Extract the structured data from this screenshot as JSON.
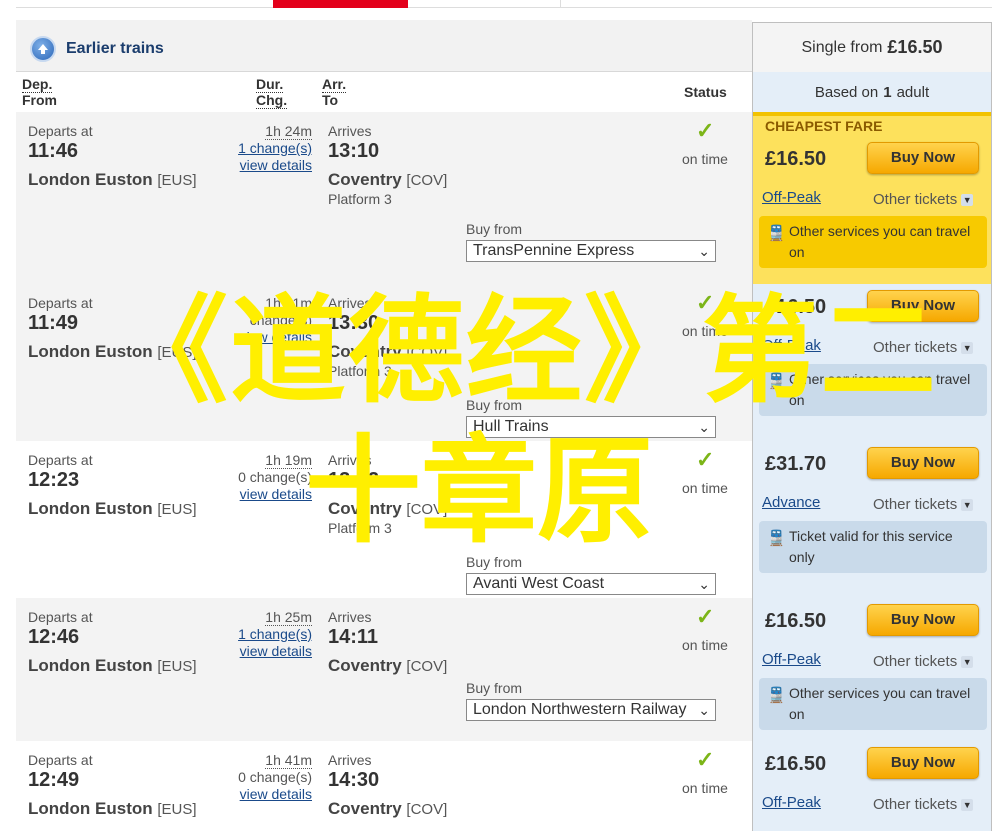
{
  "header": {
    "earlier_label": "Earlier trains",
    "single_from_label": "Single from",
    "single_from_price": "£16.50",
    "based_on_prefix": "Based on",
    "based_on_count": "1",
    "based_on_suffix": "adult"
  },
  "columns": {
    "dep_abbr": "Dep.",
    "dep_full": "From",
    "dur_abbr": "Dur.",
    "chg_abbr": "Chg.",
    "arr_abbr": "Arr.",
    "arr_full": "To",
    "status": "Status"
  },
  "labels": {
    "departs_at": "Departs at",
    "arrives": "Arrives",
    "on_time": "on time",
    "buy_from": "Buy from",
    "view_details": "view details",
    "buy_now": "Buy Now",
    "other_tickets": "Other tickets",
    "cheapest_fare": "CHEAPEST FARE"
  },
  "journeys": [
    {
      "depart_time": "11:46",
      "depart_station": "London Euston",
      "depart_code": "[EUS]",
      "duration": "1h 24m",
      "changes": "1 change(s)",
      "arrive_time": "13:10",
      "arrive_station": "Coventry",
      "arrive_code": "[COV]",
      "platform": "Platform 3",
      "operator": "TransPennine Express",
      "price": "£16.50",
      "fare_type": "Off-Peak",
      "service_note": "Other services you can travel on"
    },
    {
      "depart_time": "11:49",
      "depart_station": "London Euston",
      "depart_code": "[EUS]",
      "duration": "1h 41m",
      "changes": "change(s)",
      "arrive_time": "13:30",
      "arrive_station": "Coventry",
      "arrive_code": "[COV]",
      "platform": "Platform 3",
      "operator": "Hull Trains",
      "price": "£16.50",
      "fare_type": "Off-Peak",
      "service_note": "Other services you can travel on"
    },
    {
      "depart_time": "12:23",
      "depart_station": "London Euston",
      "depart_code": "[EUS]",
      "duration": "1h 19m",
      "changes": "0 change(s)",
      "arrive_time": "13:42",
      "arrive_station": "Coventry",
      "arrive_code": "[COV]",
      "platform": "Platform 3",
      "operator": "Avanti West Coast",
      "price": "£31.70",
      "fare_type": "Advance",
      "service_note": "Ticket valid for this service only"
    },
    {
      "depart_time": "12:46",
      "depart_station": "London Euston",
      "depart_code": "[EUS]",
      "duration": "1h 25m",
      "changes": "1 change(s)",
      "arrive_time": "14:11",
      "arrive_station": "Coventry",
      "arrive_code": "[COV]",
      "platform": "",
      "operator": "London Northwestern Railway",
      "price": "£16.50",
      "fare_type": "Off-Peak",
      "service_note": "Other services you can travel on"
    },
    {
      "depart_time": "12:49",
      "depart_station": "London Euston",
      "depart_code": "[EUS]",
      "duration": "1h 41m",
      "changes": "0 change(s)",
      "arrive_time": "14:30",
      "arrive_station": "Coventry",
      "arrive_code": "[COV]",
      "platform": "",
      "operator": "",
      "price": "£16.50",
      "fare_type": "Off-Peak",
      "service_note": ""
    }
  ],
  "watermark": {
    "line1": "《道德经》第二",
    "line2": "十章原"
  },
  "colors": {
    "brand_red": "#e3001b",
    "cheapest_yellow": "#fde15c",
    "fare_blue": "#e4eef8",
    "button_orange": "#f6a800",
    "tick_green": "#7cb518",
    "watermark_yellow": "#ffef00"
  }
}
